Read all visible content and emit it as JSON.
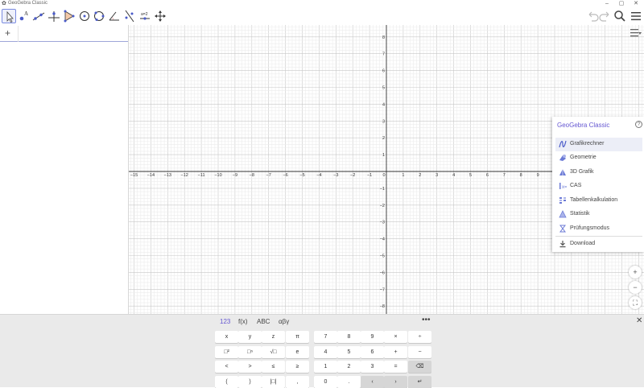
{
  "window": {
    "title": "GeoGebra Classic",
    "minimize": "–",
    "maximize": "▢",
    "close": "✕"
  },
  "toolbar": {
    "tools": [
      "move-tool",
      "point-tool",
      "line-tool",
      "perpendicular-line-tool",
      "polygon-tool",
      "circle-tool",
      "circle-through-points-tool",
      "angle-tool",
      "reflect-tool",
      "slider-tool",
      "move-graphics-tool"
    ],
    "undo": "undo",
    "redo": "redo",
    "search": "search",
    "menu": "menu"
  },
  "algebra": {
    "add_label": "+"
  },
  "graphics": {
    "x_labels": [
      "−15",
      "−14",
      "−13",
      "−12",
      "−11",
      "−10",
      "−9",
      "−8",
      "−7",
      "−6",
      "−5",
      "−4",
      "−3",
      "−2",
      "−1",
      "0",
      "1",
      "2",
      "3",
      "4",
      "5",
      "6",
      "7",
      "8",
      "9"
    ],
    "y_labels_pos": [
      "8",
      "7",
      "6",
      "5",
      "4",
      "3",
      "2",
      "1"
    ],
    "y_labels_neg": [
      "−1",
      "−2",
      "−3",
      "−4",
      "−5",
      "−6",
      "−7",
      "−8"
    ],
    "zoom_in": "+",
    "zoom_out": "−",
    "fullscreen": "⛶"
  },
  "apps_menu": {
    "header": "GeoGebra Classic",
    "help": "?",
    "items": [
      {
        "label": "Grafikrechner",
        "icon": "graphing-icon"
      },
      {
        "label": "Geometrie",
        "icon": "geometry-icon"
      },
      {
        "label": "3D Grafik",
        "icon": "3d-icon"
      },
      {
        "label": "CAS",
        "icon": "cas-icon"
      },
      {
        "label": "Tabellenkalkulation",
        "icon": "spreadsheet-icon"
      },
      {
        "label": "Statistik",
        "icon": "statistics-icon"
      },
      {
        "label": "Prüfungsmodus",
        "icon": "exam-icon"
      }
    ],
    "download": "Download"
  },
  "keyboard": {
    "tabs": [
      "123",
      "f(x)",
      "ABC",
      "αβγ"
    ],
    "more": "•••",
    "close": "✕",
    "rows": [
      [
        "x",
        "y",
        "z",
        "π",
        "7",
        "8",
        "9",
        "×",
        "÷"
      ],
      [
        "□²",
        "□ⁿ",
        "√□",
        "e",
        "4",
        "5",
        "6",
        "+",
        "−"
      ],
      [
        "<",
        ">",
        "≤",
        "≥",
        "1",
        "2",
        "3",
        "=",
        "⌫"
      ],
      [
        "(",
        ")",
        "|□|",
        ",",
        "0",
        ".",
        "‹",
        "›",
        "↵"
      ]
    ]
  }
}
